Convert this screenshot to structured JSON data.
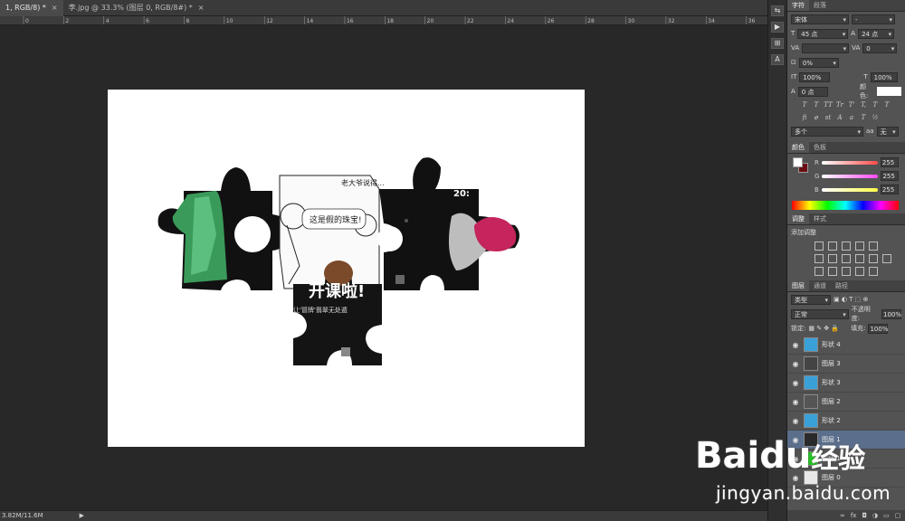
{
  "tabs": [
    {
      "label": "1, RGB/8) *",
      "active": true
    },
    {
      "label": "李.jpg @ 33.3% (图层 0, RGB/8#) *",
      "active": false
    }
  ],
  "ruler": {
    "ticks": [
      "0",
      "2",
      "4",
      "6",
      "8",
      "10",
      "12",
      "14",
      "16",
      "18",
      "20",
      "22",
      "24",
      "26",
      "28",
      "30",
      "32",
      "34",
      "36"
    ]
  },
  "status": {
    "doc_size": "3.82M/11.6M"
  },
  "canvas_text": {
    "bubble_left": "老大爷说得...",
    "bubble_right": "这是假的珠宝!",
    "headline": "开课啦!",
    "subline": "让'冒牌'翡翠无处遁",
    "badge": "20:"
  },
  "char_panel": {
    "tabs": [
      "字符",
      "段落"
    ],
    "font_family": "宋体",
    "font_style": "-",
    "size": "45 点",
    "leading": "24 点",
    "kerning": "",
    "tracking": "0",
    "scale_label": "0%",
    "vscale": "100%",
    "hscale": "100%",
    "baseline": "0 点",
    "color_label": "颜色:",
    "style_buttons": [
      "T",
      "T",
      "TT",
      "Tr",
      "T'",
      "T,",
      "T",
      "T"
    ],
    "language": "多个",
    "aa": "无"
  },
  "color_panel": {
    "tabs": [
      "颜色",
      "色板"
    ],
    "channels": [
      {
        "name": "R",
        "value": "255",
        "color": "#ff4a4a"
      },
      {
        "name": "G",
        "value": "255",
        "color": "#ff4aff"
      },
      {
        "name": "B",
        "value": "255",
        "color": "#ffff4a"
      }
    ],
    "fg_color": "#ffffff",
    "bg_color": "#6b0f14"
  },
  "adjust_panel": {
    "tabs": [
      "调整",
      "样式"
    ],
    "title": "添加调整"
  },
  "layers_panel": {
    "tabs": [
      "图层",
      "通道",
      "路径"
    ],
    "filter": "类型",
    "blend_mode": "正常",
    "opacity_label": "不透明度:",
    "opacity": "100%",
    "lock_label": "锁定:",
    "fill_label": "填充:",
    "fill": "100%",
    "layers": [
      {
        "name": "形状 4",
        "thumb": "#3aa0d8",
        "selected": false
      },
      {
        "name": "图层 3",
        "thumb": "#444444",
        "selected": false
      },
      {
        "name": "形状 3",
        "thumb": "#3aa0d8",
        "selected": false
      },
      {
        "name": "图层 2",
        "thumb": "#555555",
        "selected": false
      },
      {
        "name": "形状 2",
        "thumb": "#3aa0d8",
        "selected": false
      },
      {
        "name": "图层 1",
        "thumb": "#2a2a2a",
        "selected": true
      },
      {
        "name": "形状 1",
        "thumb": "#22cc22",
        "selected": false
      },
      {
        "name": "图层 0",
        "thumb": "#e8e8e8",
        "selected": false
      }
    ],
    "bottom_icons": [
      "链接",
      "fx",
      "蒙版",
      "调整",
      "组",
      "新建",
      "删除"
    ]
  },
  "watermark": {
    "logo": "Baidu",
    "suffix": "经验",
    "url": "jingyan.baidu.com"
  }
}
